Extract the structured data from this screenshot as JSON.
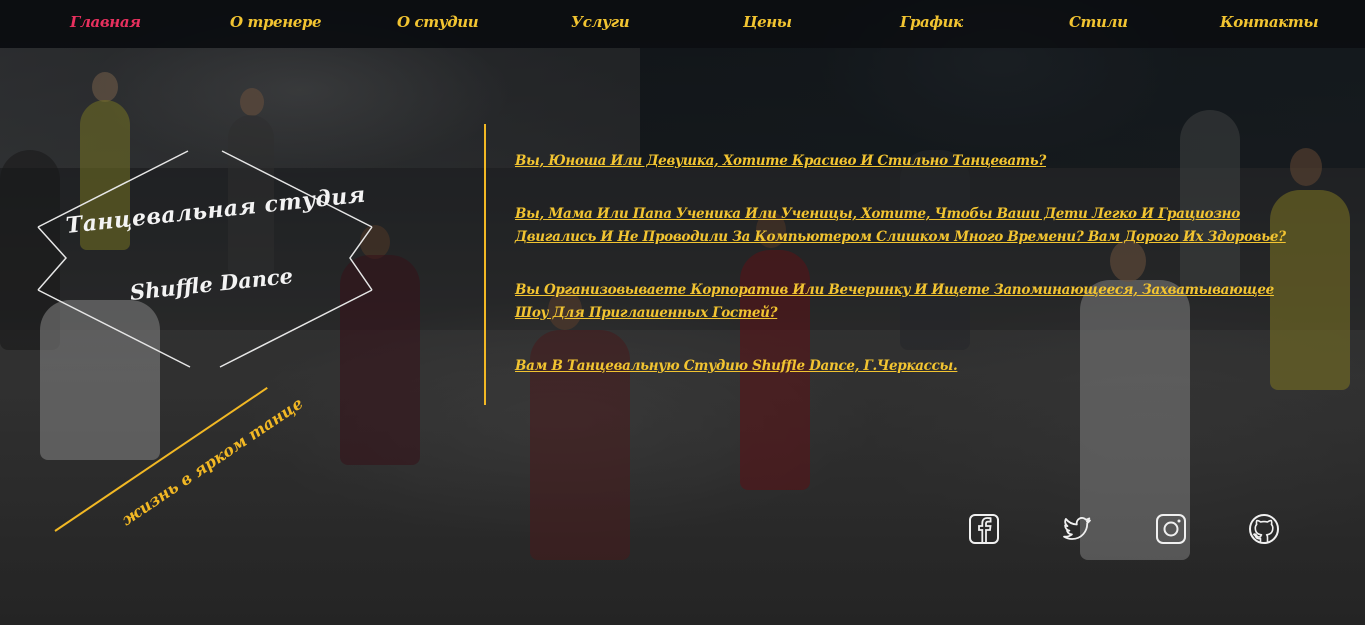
{
  "nav": {
    "items": [
      {
        "label": "Главная",
        "active": true
      },
      {
        "label": "О тренере",
        "active": false
      },
      {
        "label": "О студии",
        "active": false
      },
      {
        "label": "Услуги",
        "active": false
      },
      {
        "label": "Цены",
        "active": false
      },
      {
        "label": "График",
        "active": false
      },
      {
        "label": "Стили",
        "active": false
      },
      {
        "label": "Контакты",
        "active": false
      }
    ]
  },
  "logo": {
    "title": "Танцевальная  студия",
    "subtitle": "Shuffle Dance"
  },
  "slogan": "жизнь в ярком танце",
  "content": {
    "paragraphs": [
      "Вы, Юноша Или Девушка, Хотите Красиво И Стильно Танцевать?",
      "Вы, Мама Или Папа Ученика Или Ученицы, Хотите, Чтобы Ваши Дети Легко И Грациозно Двигались И Не Проводили За Компьютером Слишком Много Времени? Вам Дорого Их Здоровье?",
      "Вы Организовываете Корпоратив Или Вечеринку И Ищете Запоминающееся, Захватывающее Шоу Для Приглашенных Гостей?",
      "Вам В Танцевальную Студию Shuffle Dance, Г.Черкассы."
    ]
  },
  "social": [
    {
      "icon": "facebook-icon"
    },
    {
      "icon": "twitter-icon"
    },
    {
      "icon": "instagram-icon"
    },
    {
      "icon": "github-icon"
    }
  ],
  "colors": {
    "accent": "#f2c431",
    "active_nav": "#e8305e",
    "nav_bg": "#0a0c10",
    "logo_text": "#f3f3f3"
  }
}
